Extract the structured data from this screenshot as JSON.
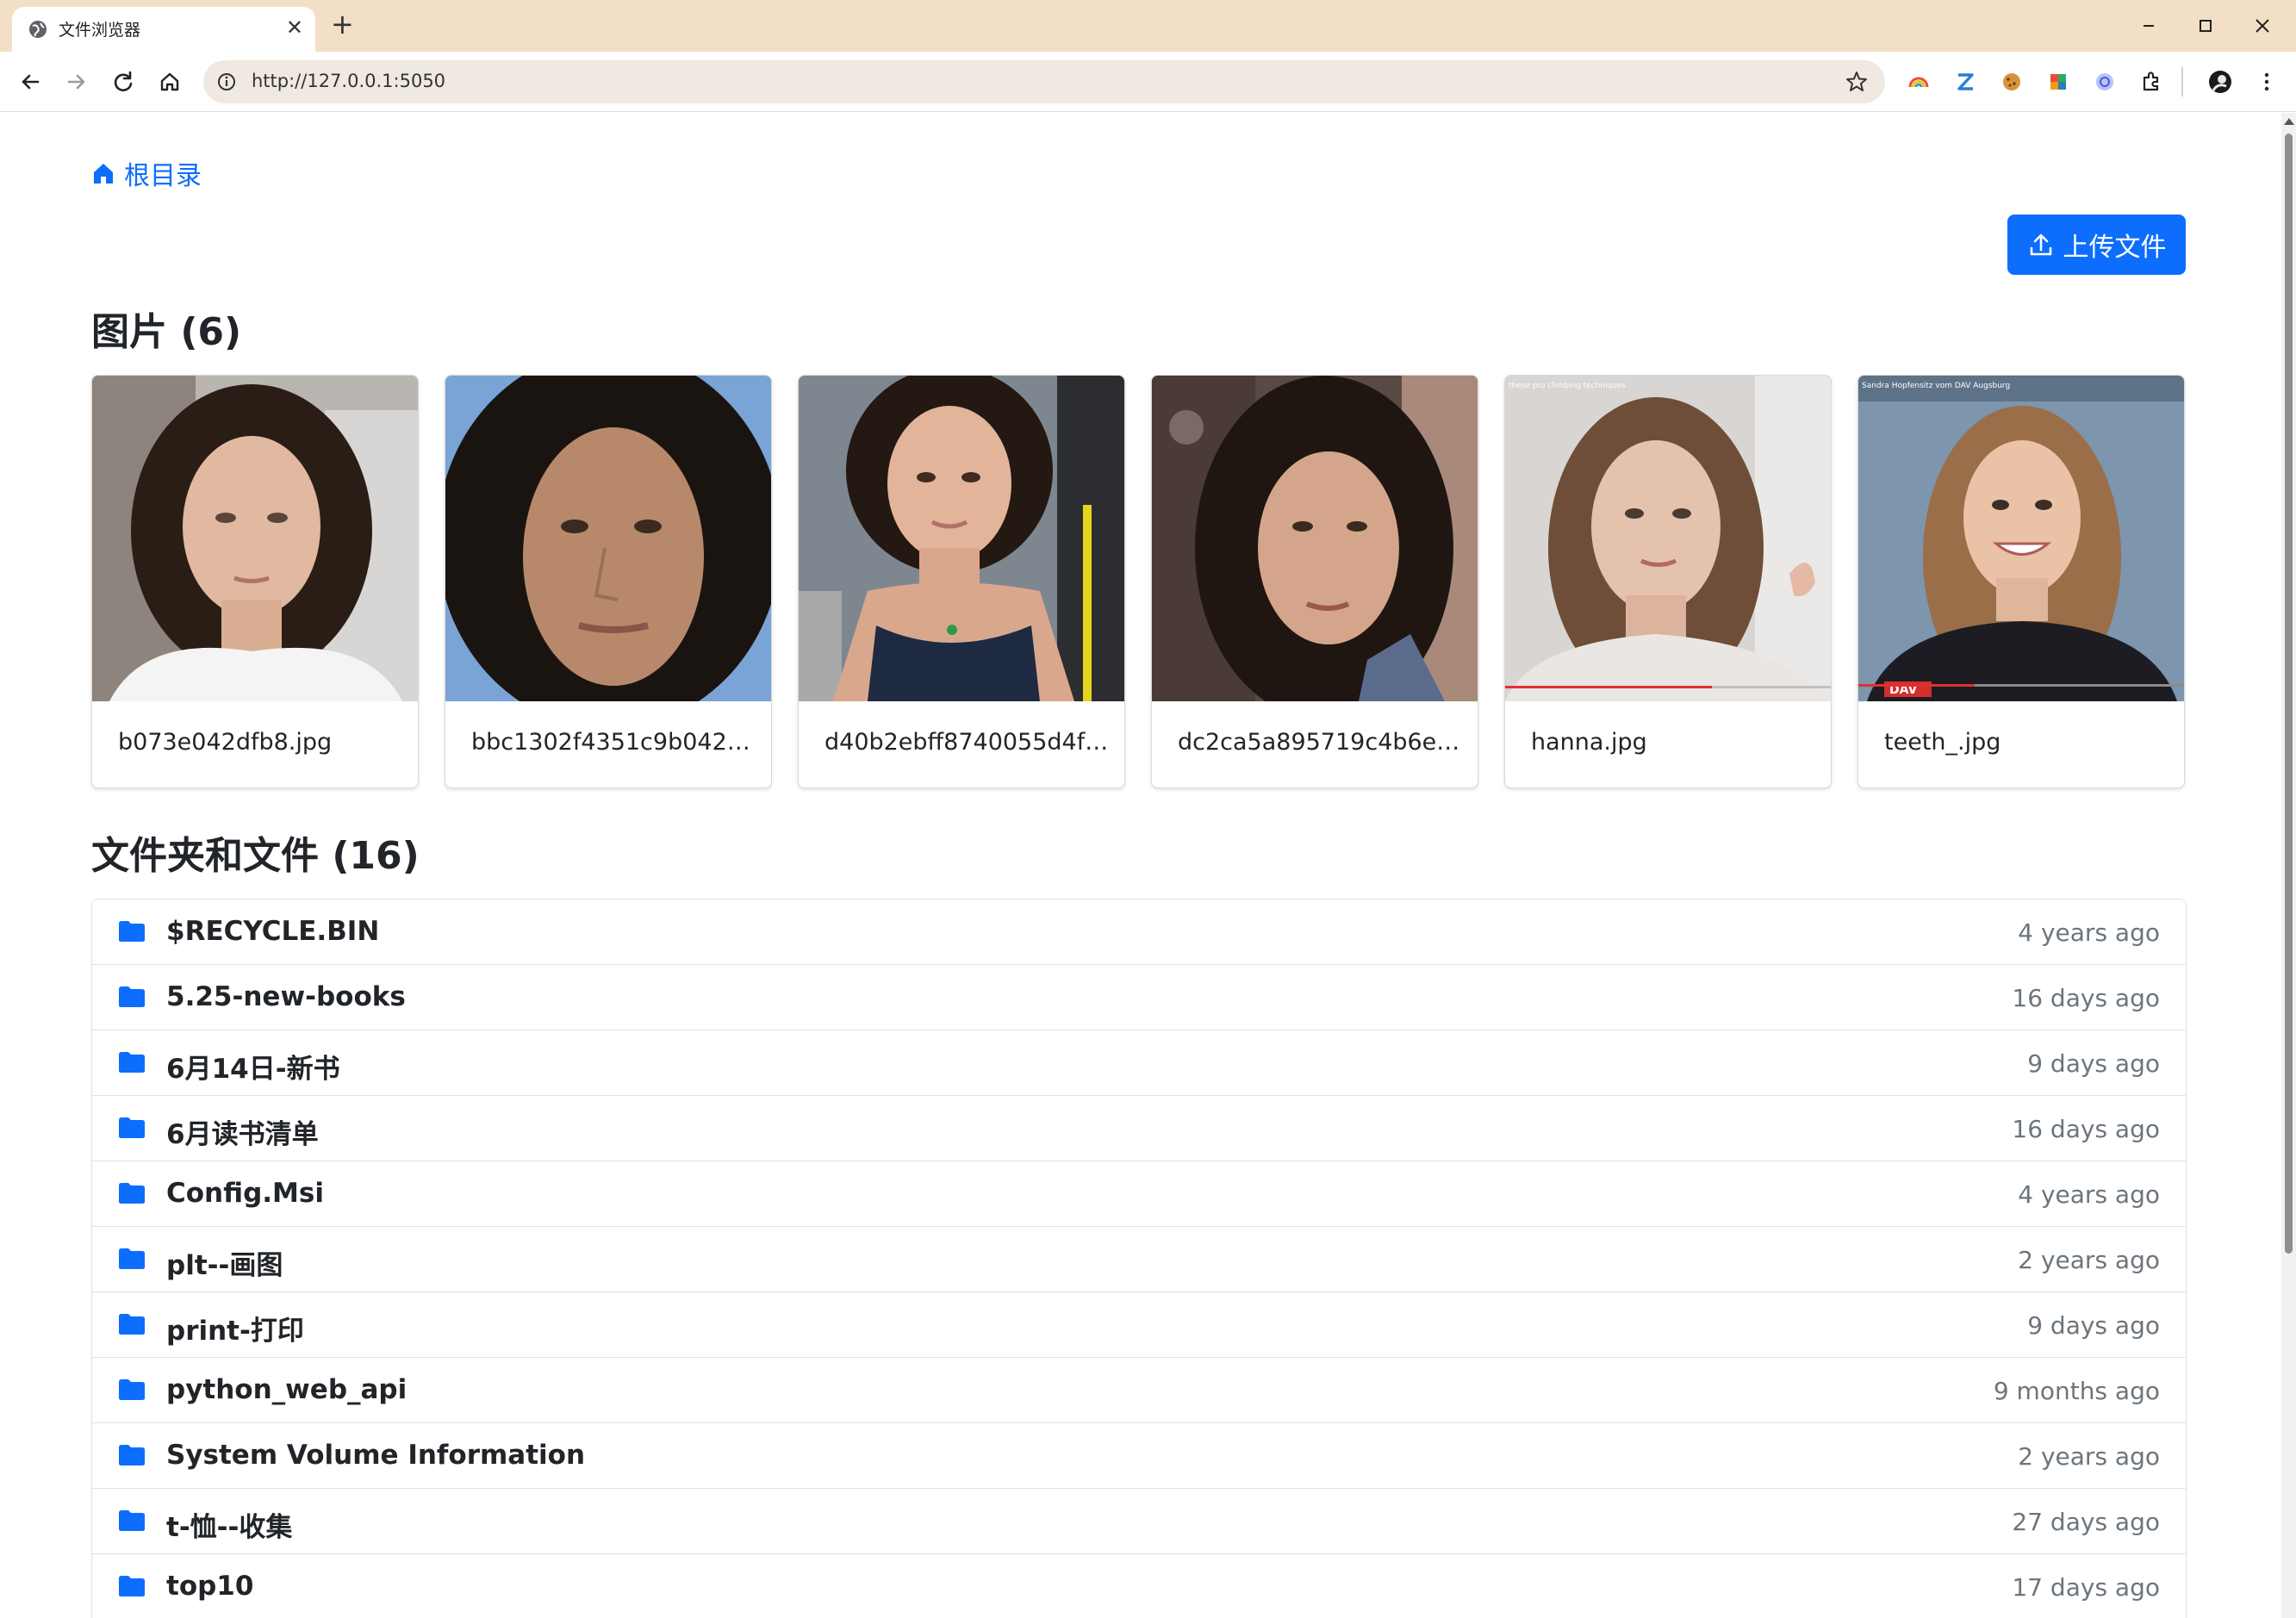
{
  "browser": {
    "tab_title": "文件浏览器",
    "tab_close": "✕",
    "new_tab": "+",
    "url": "http://127.0.0.1:5050"
  },
  "breadcrumb": {
    "label": "根目录"
  },
  "upload_button": {
    "label": "上传文件"
  },
  "images_section": {
    "title": "图片 (6)",
    "items": [
      {
        "name": "b073e042dfb8.jpg"
      },
      {
        "name": "bbc1302f4351c9b0428..."
      },
      {
        "name": "d40b2ebff8740055d4f9..."
      },
      {
        "name": "dc2ca5a895719c4b6e8..."
      },
      {
        "name": "hanna.jpg",
        "overlay": "these pro climbing techniques"
      },
      {
        "name": "teeth_.jpg",
        "overlay": "Sandra Hopfensitz vom DAV Augsburg",
        "badge": "DAV"
      }
    ]
  },
  "files_section": {
    "title": "文件夹和文件 (16)",
    "items": [
      {
        "name": "$RECYCLE.BIN",
        "modified": "4 years ago"
      },
      {
        "name": "5.25-new-books",
        "modified": "16 days ago"
      },
      {
        "name": "6月14日-新书",
        "modified": "9 days ago"
      },
      {
        "name": "6月读书清单",
        "modified": "16 days ago"
      },
      {
        "name": "Config.Msi",
        "modified": "4 years ago"
      },
      {
        "name": "plt--画图",
        "modified": "2 years ago"
      },
      {
        "name": "print-打印",
        "modified": "9 days ago"
      },
      {
        "name": "python_web_api",
        "modified": "9 months ago"
      },
      {
        "name": "System Volume Information",
        "modified": "2 years ago"
      },
      {
        "name": "t-恤--收集",
        "modified": "27 days ago"
      },
      {
        "name": "top10",
        "modified": "17 days ago"
      }
    ]
  },
  "colors": {
    "accent": "#0d6efd",
    "titlebar": "#f2dfc5"
  }
}
